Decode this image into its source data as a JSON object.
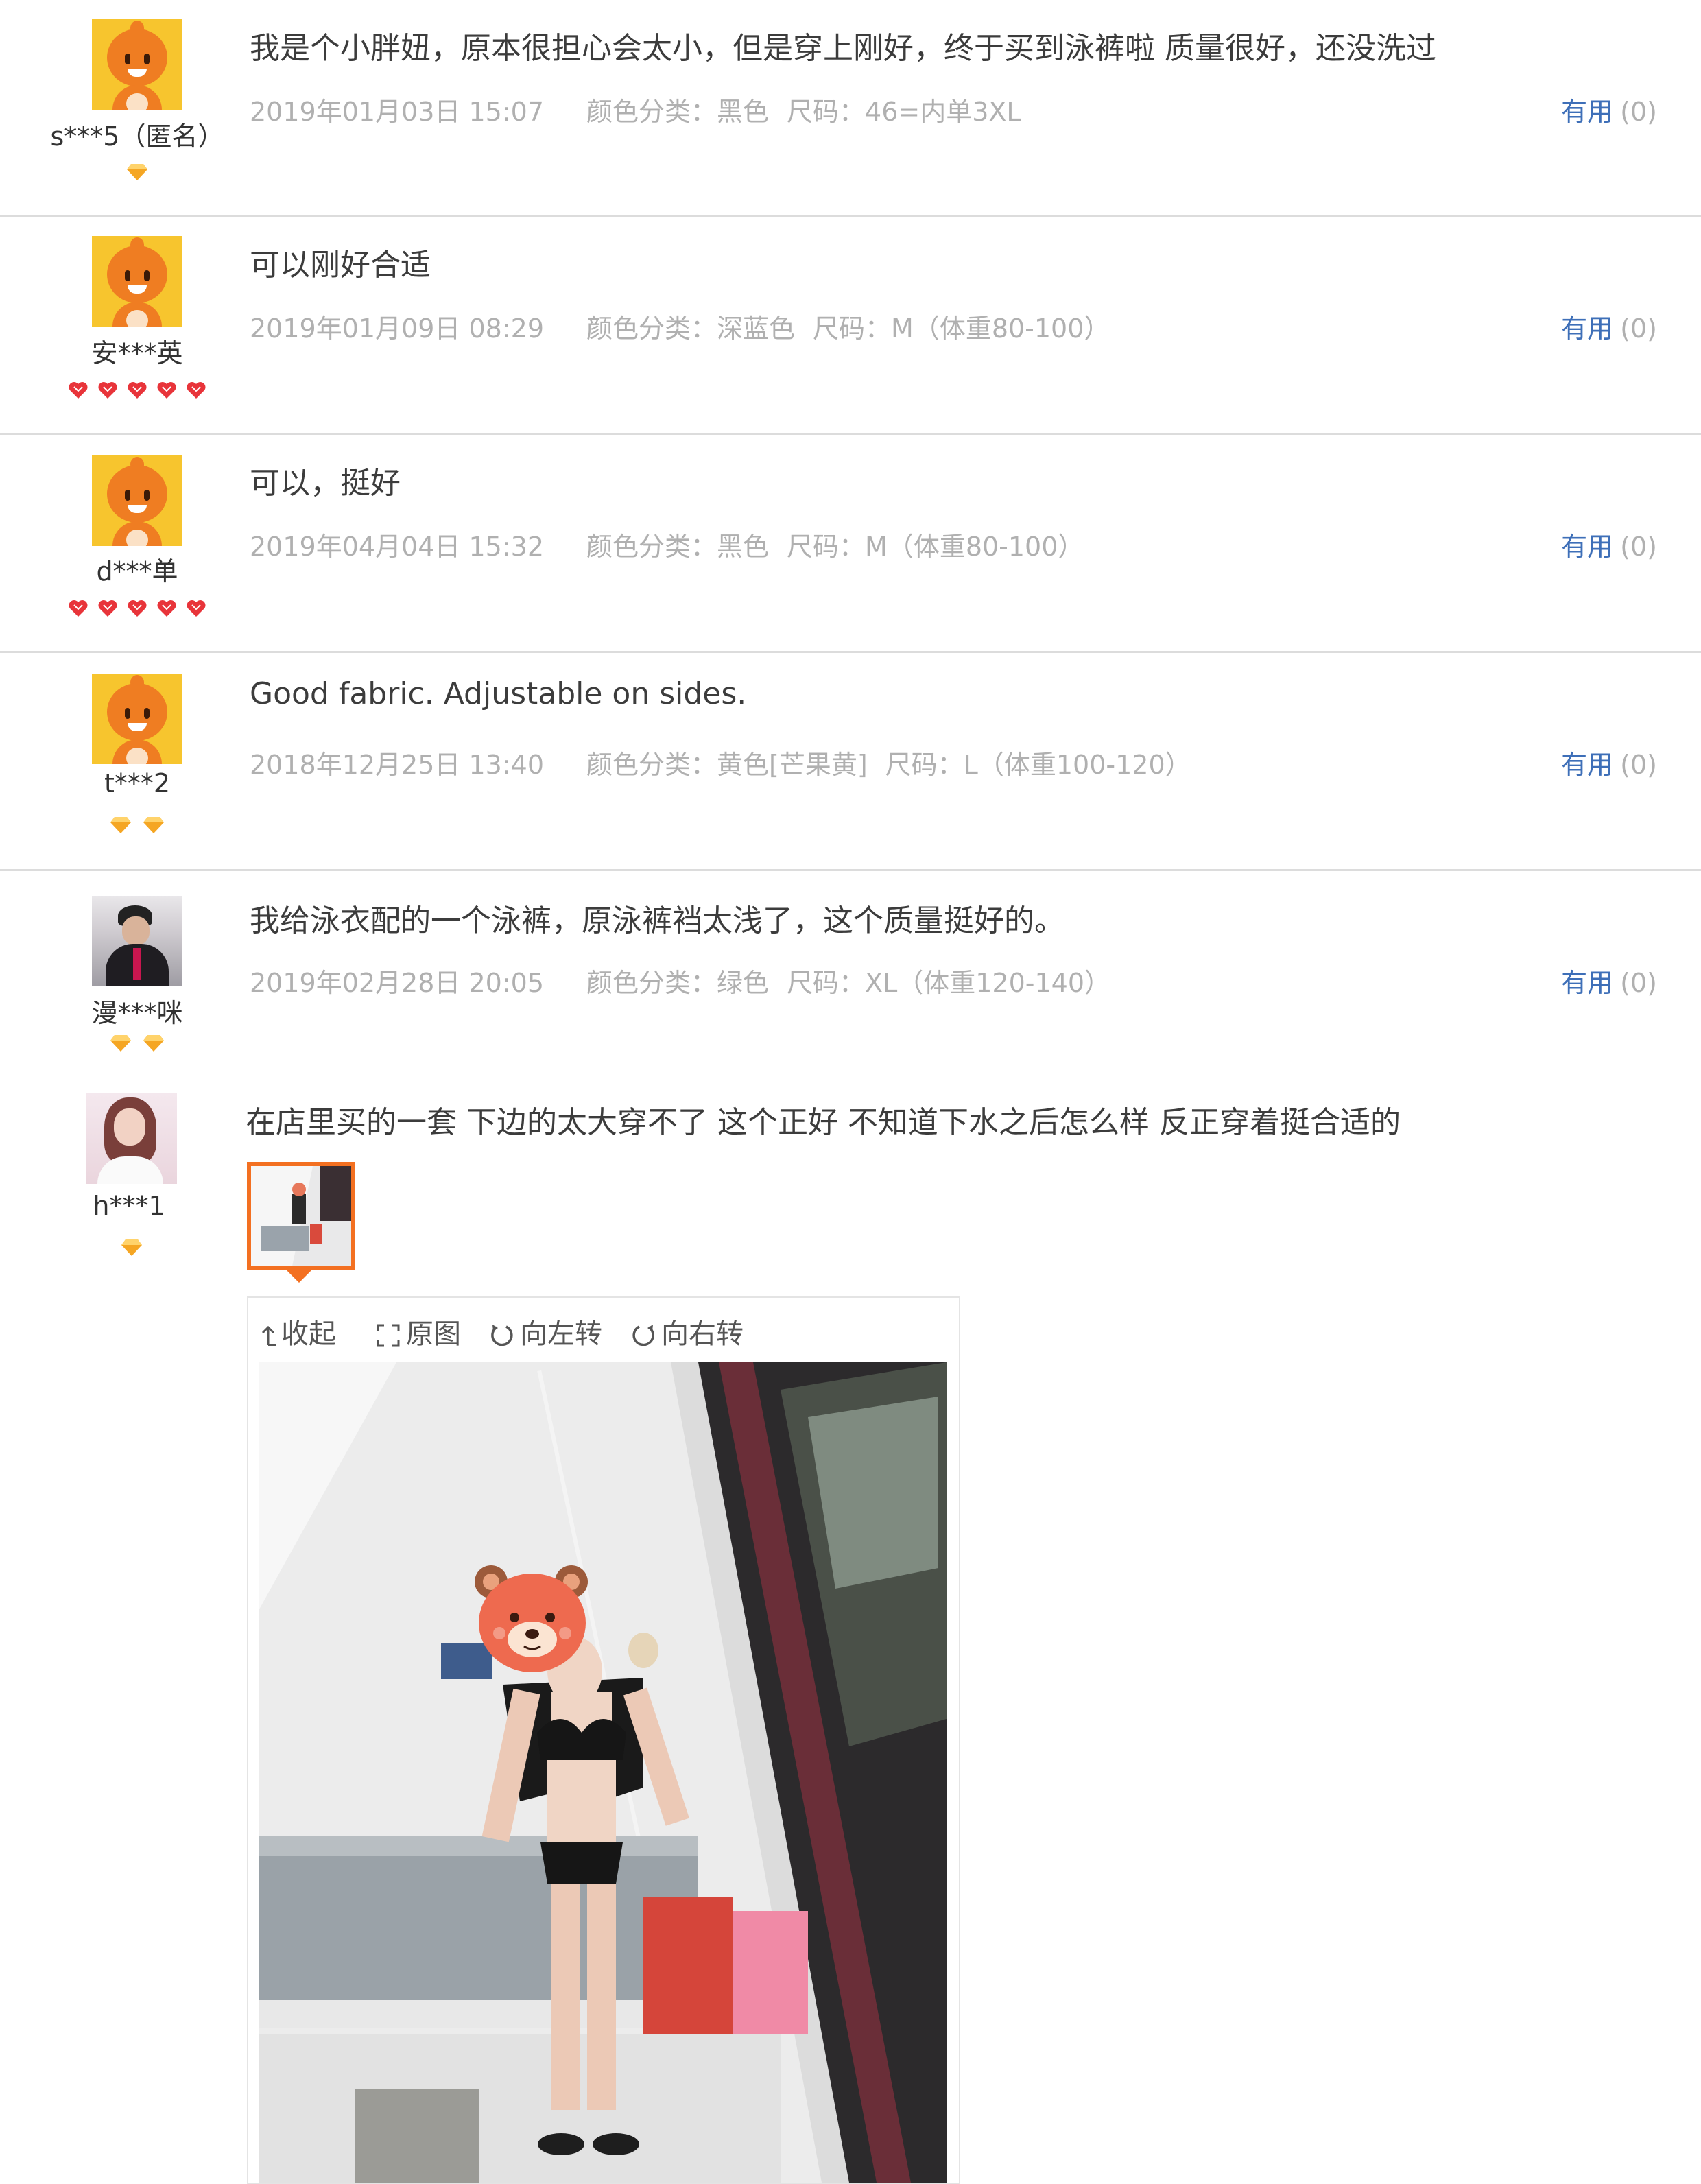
{
  "reviews": [
    {
      "user": "s***5（匿名）",
      "avatar": "cartoon-avatar",
      "badge_type": "diamond",
      "badge_count": 1,
      "comment": "我是个小胖妞，原本很担心会太小，但是穿上刚好，终于买到泳裤啦 质量很好，还没洗过",
      "date": "2019年01月03日 15:07",
      "color": "颜色分类：黑色",
      "size": "尺码：46=内单3XL",
      "useful_label": "有用",
      "useful_count": "(0)"
    },
    {
      "user": "安***英",
      "avatar": "cartoon-avatar",
      "badge_type": "heart",
      "badge_count": 5,
      "comment": "可以刚好合适",
      "date": "2019年01月09日 08:29",
      "color": "颜色分类：深蓝色",
      "size": "尺码：M（体重80-100）",
      "useful_label": "有用",
      "useful_count": "(0)"
    },
    {
      "user": "d***单",
      "avatar": "cartoon-avatar",
      "badge_type": "heart",
      "badge_count": 5,
      "comment": "可以，挺好",
      "date": "2019年04月04日 15:32",
      "color": "颜色分类：黑色",
      "size": "尺码：M（体重80-100）",
      "useful_label": "有用",
      "useful_count": "(0)"
    },
    {
      "user": "t***2",
      "avatar": "cartoon-avatar",
      "badge_type": "diamond",
      "badge_count": 2,
      "comment": "Good fabric. Adjustable on sides.",
      "date": "2018年12月25日 13:40",
      "color": "颜色分类：黄色[芒果黄]",
      "size": "尺码：L（体重100-120）",
      "useful_label": "有用",
      "useful_count": "(0)"
    },
    {
      "user": "漫***咪",
      "avatar": "photo-avatar-male",
      "badge_type": "diamond",
      "badge_count": 2,
      "comment": "我给泳衣配的一个泳裤，原泳裤裆太浅了，这个质量挺好的。",
      "date": "2019年02月28日 20:05",
      "color": "颜色分类：绿色",
      "size": "尺码：XL（体重120-140）",
      "useful_label": "有用",
      "useful_count": "(0)"
    },
    {
      "user": "h***1",
      "avatar": "photo-avatar-female",
      "badge_type": "diamond",
      "badge_count": 1,
      "comment": "在店里买的一套 下边的太大穿不了 这个正好 不知道下水之后怎么样 反正穿着挺合适的"
    }
  ],
  "viewer": {
    "toolbar": {
      "collapse": "收起",
      "original": "原图",
      "rotate_left": "向左转",
      "rotate_right": "向右转"
    }
  },
  "colors": {
    "useful_link": "#3e6fb8",
    "meta_text": "#b0b0b0",
    "thumb_border": "#f37021",
    "badge_heart": "#e8343a",
    "badge_diamond": "#f5a623"
  }
}
